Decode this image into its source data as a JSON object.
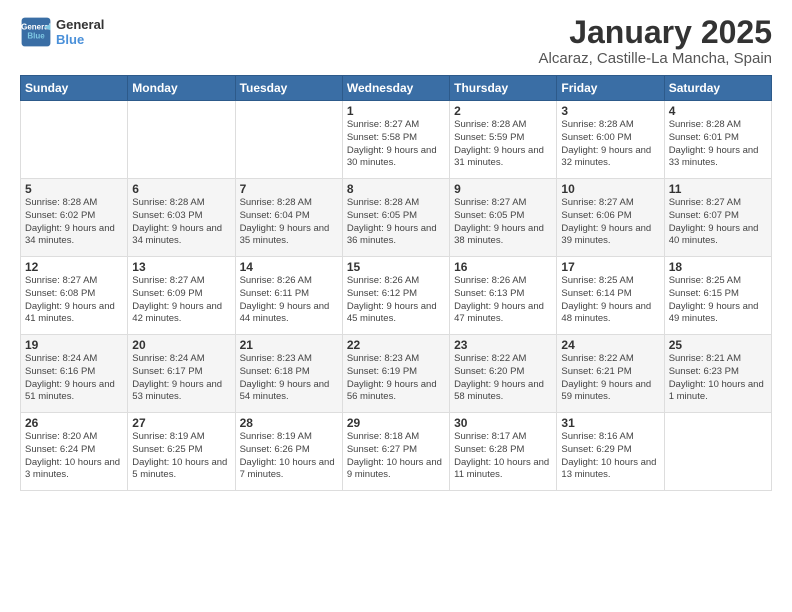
{
  "logo": {
    "line1": "General",
    "line2": "Blue"
  },
  "title": "January 2025",
  "location": "Alcaraz, Castille-La Mancha, Spain",
  "weekdays": [
    "Sunday",
    "Monday",
    "Tuesday",
    "Wednesday",
    "Thursday",
    "Friday",
    "Saturday"
  ],
  "weeks": [
    [
      {
        "num": "",
        "info": ""
      },
      {
        "num": "",
        "info": ""
      },
      {
        "num": "",
        "info": ""
      },
      {
        "num": "1",
        "info": "Sunrise: 8:27 AM\nSunset: 5:58 PM\nDaylight: 9 hours and 30 minutes."
      },
      {
        "num": "2",
        "info": "Sunrise: 8:28 AM\nSunset: 5:59 PM\nDaylight: 9 hours and 31 minutes."
      },
      {
        "num": "3",
        "info": "Sunrise: 8:28 AM\nSunset: 6:00 PM\nDaylight: 9 hours and 32 minutes."
      },
      {
        "num": "4",
        "info": "Sunrise: 8:28 AM\nSunset: 6:01 PM\nDaylight: 9 hours and 33 minutes."
      }
    ],
    [
      {
        "num": "5",
        "info": "Sunrise: 8:28 AM\nSunset: 6:02 PM\nDaylight: 9 hours and 34 minutes."
      },
      {
        "num": "6",
        "info": "Sunrise: 8:28 AM\nSunset: 6:03 PM\nDaylight: 9 hours and 34 minutes."
      },
      {
        "num": "7",
        "info": "Sunrise: 8:28 AM\nSunset: 6:04 PM\nDaylight: 9 hours and 35 minutes."
      },
      {
        "num": "8",
        "info": "Sunrise: 8:28 AM\nSunset: 6:05 PM\nDaylight: 9 hours and 36 minutes."
      },
      {
        "num": "9",
        "info": "Sunrise: 8:27 AM\nSunset: 6:05 PM\nDaylight: 9 hours and 38 minutes."
      },
      {
        "num": "10",
        "info": "Sunrise: 8:27 AM\nSunset: 6:06 PM\nDaylight: 9 hours and 39 minutes."
      },
      {
        "num": "11",
        "info": "Sunrise: 8:27 AM\nSunset: 6:07 PM\nDaylight: 9 hours and 40 minutes."
      }
    ],
    [
      {
        "num": "12",
        "info": "Sunrise: 8:27 AM\nSunset: 6:08 PM\nDaylight: 9 hours and 41 minutes."
      },
      {
        "num": "13",
        "info": "Sunrise: 8:27 AM\nSunset: 6:09 PM\nDaylight: 9 hours and 42 minutes."
      },
      {
        "num": "14",
        "info": "Sunrise: 8:26 AM\nSunset: 6:11 PM\nDaylight: 9 hours and 44 minutes."
      },
      {
        "num": "15",
        "info": "Sunrise: 8:26 AM\nSunset: 6:12 PM\nDaylight: 9 hours and 45 minutes."
      },
      {
        "num": "16",
        "info": "Sunrise: 8:26 AM\nSunset: 6:13 PM\nDaylight: 9 hours and 47 minutes."
      },
      {
        "num": "17",
        "info": "Sunrise: 8:25 AM\nSunset: 6:14 PM\nDaylight: 9 hours and 48 minutes."
      },
      {
        "num": "18",
        "info": "Sunrise: 8:25 AM\nSunset: 6:15 PM\nDaylight: 9 hours and 49 minutes."
      }
    ],
    [
      {
        "num": "19",
        "info": "Sunrise: 8:24 AM\nSunset: 6:16 PM\nDaylight: 9 hours and 51 minutes."
      },
      {
        "num": "20",
        "info": "Sunrise: 8:24 AM\nSunset: 6:17 PM\nDaylight: 9 hours and 53 minutes."
      },
      {
        "num": "21",
        "info": "Sunrise: 8:23 AM\nSunset: 6:18 PM\nDaylight: 9 hours and 54 minutes."
      },
      {
        "num": "22",
        "info": "Sunrise: 8:23 AM\nSunset: 6:19 PM\nDaylight: 9 hours and 56 minutes."
      },
      {
        "num": "23",
        "info": "Sunrise: 8:22 AM\nSunset: 6:20 PM\nDaylight: 9 hours and 58 minutes."
      },
      {
        "num": "24",
        "info": "Sunrise: 8:22 AM\nSunset: 6:21 PM\nDaylight: 9 hours and 59 minutes."
      },
      {
        "num": "25",
        "info": "Sunrise: 8:21 AM\nSunset: 6:23 PM\nDaylight: 10 hours and 1 minute."
      }
    ],
    [
      {
        "num": "26",
        "info": "Sunrise: 8:20 AM\nSunset: 6:24 PM\nDaylight: 10 hours and 3 minutes."
      },
      {
        "num": "27",
        "info": "Sunrise: 8:19 AM\nSunset: 6:25 PM\nDaylight: 10 hours and 5 minutes."
      },
      {
        "num": "28",
        "info": "Sunrise: 8:19 AM\nSunset: 6:26 PM\nDaylight: 10 hours and 7 minutes."
      },
      {
        "num": "29",
        "info": "Sunrise: 8:18 AM\nSunset: 6:27 PM\nDaylight: 10 hours and 9 minutes."
      },
      {
        "num": "30",
        "info": "Sunrise: 8:17 AM\nSunset: 6:28 PM\nDaylight: 10 hours and 11 minutes."
      },
      {
        "num": "31",
        "info": "Sunrise: 8:16 AM\nSunset: 6:29 PM\nDaylight: 10 hours and 13 minutes."
      },
      {
        "num": "",
        "info": ""
      }
    ]
  ]
}
